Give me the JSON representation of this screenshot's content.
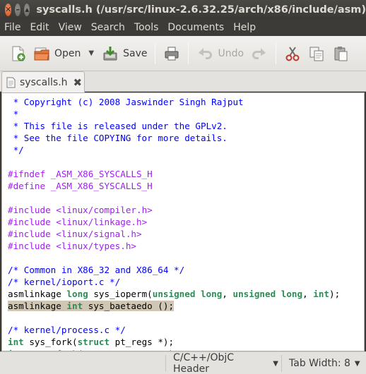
{
  "window": {
    "title": "syscalls.h (/usr/src/linux-2.6.32.25/arch/x86/include/asm)",
    "close_glyph": "✕",
    "minimize_glyph": "–",
    "maximize_glyph": "▴"
  },
  "menu": [
    "File",
    "Edit",
    "View",
    "Search",
    "Tools",
    "Documents",
    "Help"
  ],
  "toolbar": {
    "new_icon": "new-document-icon",
    "open_label": "Open",
    "save_label": "Save",
    "undo_label": "Undo",
    "dropdown_glyph": "▼"
  },
  "tab": {
    "label": "syscalls.h",
    "close_glyph": "✖"
  },
  "code_lines": [
    [
      {
        "t": " * Copyright (c) 2008 Jaswinder Singh Rajput",
        "c": "c-com"
      }
    ],
    [
      {
        "t": " *",
        "c": "c-com"
      }
    ],
    [
      {
        "t": " * This file is released under the GPLv2.",
        "c": "c-com"
      }
    ],
    [
      {
        "t": " * See the file COPYING for more details.",
        "c": "c-com"
      }
    ],
    [
      {
        "t": " */",
        "c": "c-com"
      }
    ],
    [],
    [
      {
        "t": "#ifndef _ASM_X86_SYSCALLS_H",
        "c": "c-pp"
      }
    ],
    [
      {
        "t": "#define _ASM_X86_SYSCALLS_H",
        "c": "c-pp"
      }
    ],
    [],
    [
      {
        "t": "#include ",
        "c": "c-pp"
      },
      {
        "t": "<linux/compiler.h>",
        "c": "c-pp"
      }
    ],
    [
      {
        "t": "#include ",
        "c": "c-pp"
      },
      {
        "t": "<linux/linkage.h>",
        "c": "c-pp"
      }
    ],
    [
      {
        "t": "#include ",
        "c": "c-pp"
      },
      {
        "t": "<linux/signal.h>",
        "c": "c-pp"
      }
    ],
    [
      {
        "t": "#include ",
        "c": "c-pp"
      },
      {
        "t": "<linux/types.h>",
        "c": "c-pp"
      }
    ],
    [],
    [
      {
        "t": "/* Common in X86_32 and X86_64 */",
        "c": "c-com"
      }
    ],
    [
      {
        "t": "/* kernel/ioport.c */",
        "c": "c-com"
      }
    ],
    [
      {
        "t": "asmlinkage ",
        "c": "c-plain"
      },
      {
        "t": "long",
        "c": "c-kw"
      },
      {
        "t": " sys_ioperm(",
        "c": "c-plain"
      },
      {
        "t": "unsigned long",
        "c": "c-kw"
      },
      {
        "t": ", ",
        "c": "c-plain"
      },
      {
        "t": "unsigned long",
        "c": "c-kw"
      },
      {
        "t": ", ",
        "c": "c-plain"
      },
      {
        "t": "int",
        "c": "c-kw"
      },
      {
        "t": ");",
        "c": "c-plain"
      }
    ],
    [
      {
        "t": "asmlinkage ",
        "c": "c-plain",
        "hl": true
      },
      {
        "t": "int",
        "c": "c-kw",
        "hl": true
      },
      {
        "t": " sys_baetaedo ();",
        "c": "c-plain",
        "hl": true
      }
    ],
    [],
    [
      {
        "t": "/* kernel/process.c */",
        "c": "c-com"
      }
    ],
    [
      {
        "t": "int",
        "c": "c-kw"
      },
      {
        "t": " sys_fork(",
        "c": "c-plain"
      },
      {
        "t": "struct",
        "c": "c-kw"
      },
      {
        "t": " pt_regs *);",
        "c": "c-plain"
      }
    ],
    [
      {
        "t": "int",
        "c": "c-kw"
      },
      {
        "t": " sys_vfork(",
        "c": "c-plain"
      },
      {
        "t": "struct",
        "c": "c-kw"
      },
      {
        "t": " pt_regs *);",
        "c": "c-plain"
      }
    ]
  ],
  "status": {
    "language": "C/C++/ObjC Header",
    "tab_width": "Tab Width:  8",
    "dropdown_glyph": "▼"
  },
  "colors": {
    "comment": "#0000ff",
    "preprocessor": "#a020f0",
    "keyword": "#2e8b57",
    "highlight": "#cfc6b4"
  }
}
